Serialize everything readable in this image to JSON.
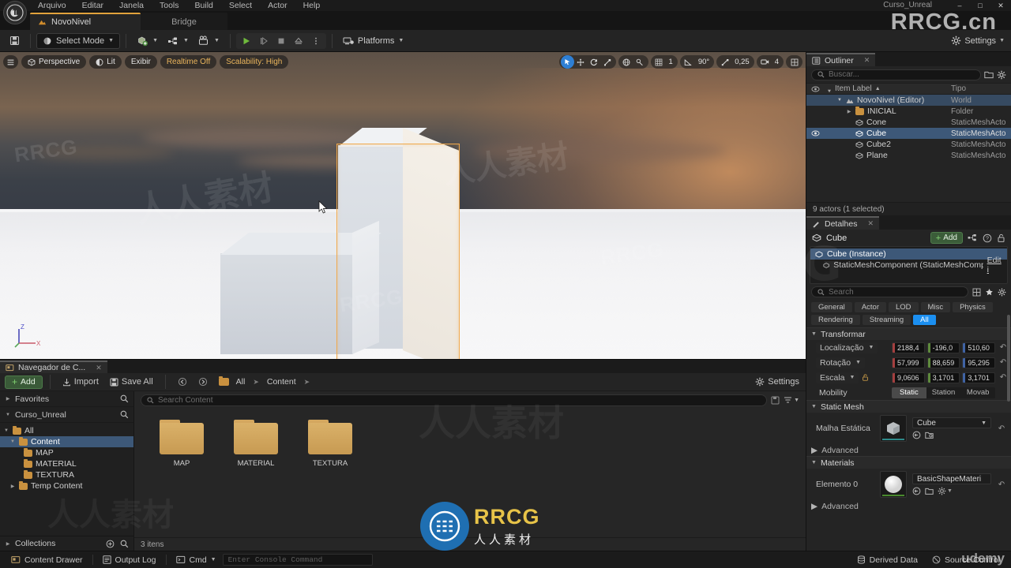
{
  "window": {
    "project_name": "Curso_Unreal",
    "controls": [
      "minimize",
      "maximize",
      "close"
    ]
  },
  "menubar": {
    "items": [
      "Arquivo",
      "Editar",
      "Janela",
      "Tools",
      "Build",
      "Select",
      "Actor",
      "Help"
    ]
  },
  "tabs": {
    "level_tab": "NovoNivel",
    "bridge_tab": "Bridge"
  },
  "toolbar": {
    "save_icon": "save-icon",
    "select_mode": "Select Mode",
    "platforms": "Platforms",
    "settings": "Settings",
    "play_icons": [
      "play-icon",
      "skip-icon",
      "stop-icon",
      "eject-icon",
      "more-icon"
    ]
  },
  "viewport": {
    "left_chips": [
      {
        "label": "Perspective",
        "icon": "cube-icon",
        "amber": false
      },
      {
        "label": "Lit",
        "icon": "lit-icon",
        "amber": false
      },
      {
        "label": "Exibir",
        "icon": "",
        "amber": false
      },
      {
        "label": "Realtime Off",
        "icon": "",
        "amber": true
      },
      {
        "label": "Scalability: High",
        "icon": "",
        "amber": true
      }
    ],
    "transform_tools": [
      "select-arrow-icon",
      "move-icon",
      "rotate-icon",
      "scale-icon"
    ],
    "coord_tools": [
      "world-space-icon",
      "surface-snap-icon"
    ],
    "grid_snap_value": "1",
    "angle_snap_value": "90°",
    "scale_snap_value": "0,25",
    "camera_speed_value": "4",
    "layout_icon": "viewport-layout-icon",
    "gizmo_axes": [
      "Z",
      "X"
    ]
  },
  "outliner": {
    "title": "Outliner",
    "search_placeholder": "Buscar...",
    "columns": [
      "Item Label",
      "Tipo"
    ],
    "rows": [
      {
        "label": "NovoNivel (Editor)",
        "type": "World",
        "icon": "level-icon",
        "indent": 1,
        "expanded": true,
        "selected": true,
        "eye": false
      },
      {
        "label": "INICIAL",
        "type": "Folder",
        "icon": "folder-icon",
        "indent": 2,
        "collapsed": true,
        "selected": false,
        "eye": false
      },
      {
        "label": "Cone",
        "type": "StaticMeshActo",
        "icon": "mesh-icon",
        "indent": 3,
        "selected": false,
        "eye": false
      },
      {
        "label": "Cube",
        "type": "StaticMeshActo",
        "icon": "mesh-icon",
        "indent": 3,
        "selected": true,
        "eye": true
      },
      {
        "label": "Cube2",
        "type": "StaticMeshActo",
        "icon": "mesh-icon",
        "indent": 3,
        "selected": false,
        "eye": false
      },
      {
        "label": "Plane",
        "type": "StaticMeshActo",
        "icon": "mesh-icon",
        "indent": 3,
        "selected": false,
        "eye": false
      }
    ],
    "status": "9 actors (1 selected)"
  },
  "details": {
    "title": "Detalhes",
    "actor_name": "Cube",
    "add_label": "Add",
    "components": [
      {
        "label": "Cube (Instance)",
        "selected": true,
        "edit": ""
      },
      {
        "label": "StaticMeshComponent (StaticMeshComponent0)",
        "selected": false,
        "edit": "Edit i"
      }
    ],
    "search_placeholder": "Search",
    "filters": [
      {
        "label": "General",
        "active": false
      },
      {
        "label": "Actor",
        "active": false
      },
      {
        "label": "LOD",
        "active": false
      },
      {
        "label": "Misc",
        "active": false
      },
      {
        "label": "Physics",
        "active": false
      },
      {
        "label": "Rendering",
        "active": false
      },
      {
        "label": "Streaming",
        "active": false
      },
      {
        "label": "All",
        "active": true
      }
    ],
    "transform": {
      "section": "Transformar",
      "rows": [
        {
          "label": "Localização",
          "x": "2188,4",
          "y": "-196,0",
          "z": "510,60"
        },
        {
          "label": "Rotação",
          "x": "57,999",
          "y": "88,659",
          "z": "95,295"
        },
        {
          "label": "Escala",
          "x": "9,0606",
          "y": "3,1701",
          "z": "3,1701",
          "locked": false
        }
      ],
      "mobility_label": "Mobility",
      "mobility_options": [
        "Static",
        "Station",
        "Movab"
      ],
      "mobility_selected": "Static"
    },
    "static_mesh": {
      "section": "Static Mesh",
      "label": "Malha Estática",
      "value": "Cube",
      "advanced": "Advanced"
    },
    "materials": {
      "section": "Materials",
      "label": "Elemento 0",
      "value": "BasicShapeMateri",
      "advanced": "Advanced"
    }
  },
  "content_browser": {
    "tab_title": "Navegador de C...",
    "add_label": "Add",
    "import_label": "Import",
    "save_all_label": "Save All",
    "breadcrumb": [
      "All",
      "Content"
    ],
    "settings_label": "Settings",
    "favorites_label": "Favorites",
    "project_label": "Curso_Unreal",
    "collections_label": "Collections",
    "search_placeholder": "Search Content",
    "tree": [
      {
        "label": "All",
        "indent": 0,
        "expanded": true,
        "selected": false
      },
      {
        "label": "Content",
        "indent": 1,
        "expanded": true,
        "selected": true
      },
      {
        "label": "MAP",
        "indent": 2,
        "expanded": false,
        "selected": false
      },
      {
        "label": "MATERIAL",
        "indent": 2,
        "expanded": false,
        "selected": false
      },
      {
        "label": "TEXTURA",
        "indent": 2,
        "expanded": false,
        "selected": false
      },
      {
        "label": "Temp Content",
        "indent": 1,
        "collapsed": true,
        "selected": false
      }
    ],
    "assets": [
      {
        "label": "MAP",
        "kind": "folder"
      },
      {
        "label": "MATERIAL",
        "kind": "folder"
      },
      {
        "label": "TEXTURA",
        "kind": "folder"
      }
    ],
    "status": "3 itens"
  },
  "statusbar": {
    "content_drawer": "Content Drawer",
    "output_log": "Output Log",
    "cmd": "Cmd",
    "console_placeholder": "Enter Console Command",
    "derived_data": "Derived Data",
    "source_control": "Source Control"
  },
  "watermarks": {
    "brand": "RRCG",
    "domain": ".cn",
    "chinese": "人人素材",
    "udemy": "udemy",
    "corner": "RRCG.cn"
  }
}
